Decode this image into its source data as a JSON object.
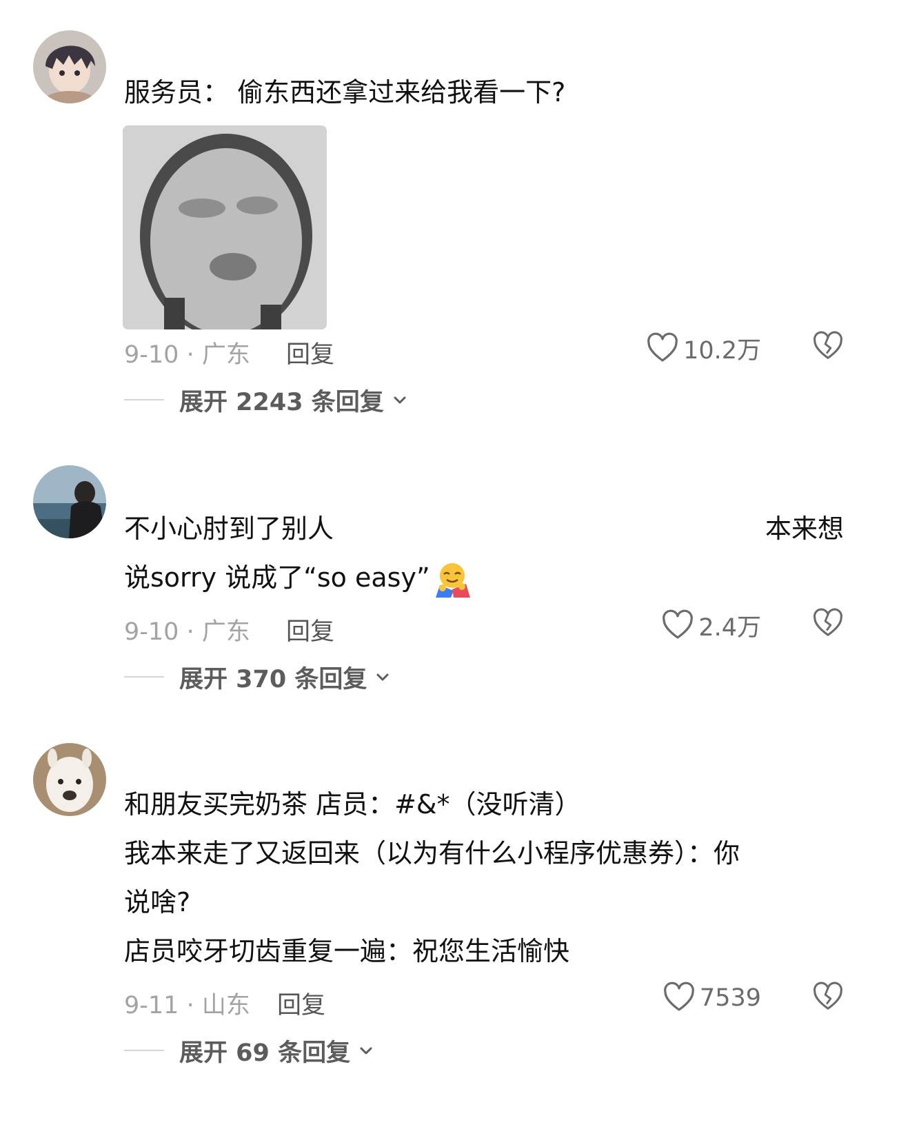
{
  "comments": [
    {
      "text_lines": [
        "服务员： 偷东西还拿过来给我看一下?"
      ],
      "date": "9-10",
      "location": "广东",
      "reply_label": "回复",
      "likes": "10.2万",
      "expand_label": "展开 2243 条回复"
    },
    {
      "text_line1_left": "不小心肘到了别人",
      "text_line1_right": "本来想",
      "text_line2": "说sorry 说成了“so easy”",
      "emoji": "hugging-face-emoji",
      "date": "9-10",
      "location": "广东",
      "reply_label": "回复",
      "likes": "2.4万",
      "expand_label": "展开 370 条回复"
    },
    {
      "text_lines": [
        "和朋友买完奶茶 店员：#&*（没听清）",
        "我本来走了又返回来（以为有什么小程序优惠券）：你",
        "说啥?",
        "店员咬牙切齿重复一遍：祝您生活愉快"
      ],
      "date": "9-11",
      "location": "山东",
      "reply_label": "回复",
      "likes": "7539",
      "expand_label": "展开 69 条回复"
    }
  ],
  "icons": {
    "like": "heart-outline-icon",
    "dislike": "broken-heart-icon",
    "expand": "chevron-down-icon"
  },
  "colors": {
    "meta_gray": "#a3a3a3",
    "reply_gray": "#555555",
    "expand_gray": "#5c5c5c"
  }
}
